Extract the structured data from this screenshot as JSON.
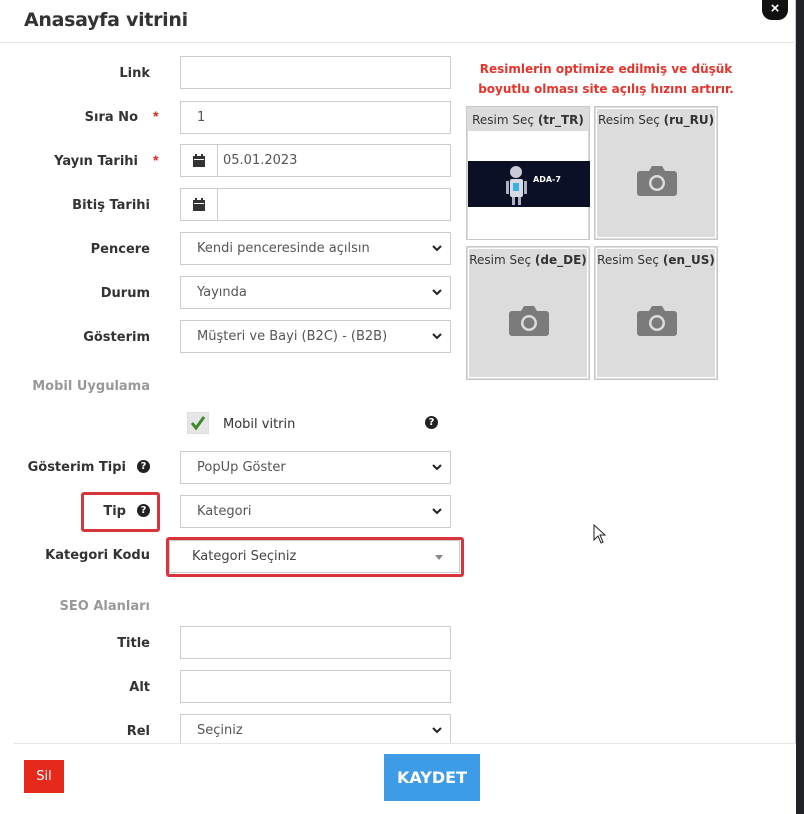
{
  "modal": {
    "title": "Anasayfa vitrini",
    "close_label": "×"
  },
  "form": {
    "link_label": "Link",
    "link_value": "",
    "sira_label": "Sıra No",
    "sira_value": "1",
    "required_mark": "*",
    "yayin_label": "Yayın Tarihi",
    "yayin_value": "05.01.2023",
    "bitis_label": "Bitiş Tarihi",
    "bitis_value": "",
    "pencere_label": "Pencere",
    "pencere_value": "Kendi penceresinde açılsın",
    "durum_label": "Durum",
    "durum_value": "Yayında",
    "gosterim_label": "Gösterim",
    "gosterim_value": "Müşteri ve Bayi (B2C) - (B2B)",
    "mobil_section": "Mobil Uygulama",
    "mobil_checkbox_label": "Mobil vitrin",
    "mobil_checked": true,
    "gosterim_tipi_label": "Gösterim Tipi",
    "gosterim_tipi_value": "PopUp Göster",
    "tip_label": "Tip",
    "tip_value": "Kategori",
    "kategori_label": "Kategori Kodu",
    "kategori_value": "Kategori Seçiniz",
    "seo_section": "SEO Alanları",
    "title_label": "Title",
    "title_value": "",
    "alt_label": "Alt",
    "alt_value": "",
    "rel_label": "Rel",
    "rel_value": "Seçiniz",
    "help_glyph": "?"
  },
  "images": {
    "warning": "Resimlerin optimize edilmiş ve düşük boyutlu olması site açılış hızını artırır.",
    "select_prefix": "Resim Seç",
    "tiles": [
      {
        "lang": "(tr_TR)",
        "has_image": true,
        "banner_text": "ADA-7"
      },
      {
        "lang": "(ru_RU)",
        "has_image": false
      },
      {
        "lang": "(de_DE)",
        "has_image": false
      },
      {
        "lang": "(en_US)",
        "has_image": false
      }
    ]
  },
  "footer": {
    "delete_label": "Sil",
    "save_label": "KAYDET"
  },
  "colors": {
    "danger": "#e5291b",
    "primary": "#3e9ce6",
    "highlight": "#d9333c"
  }
}
